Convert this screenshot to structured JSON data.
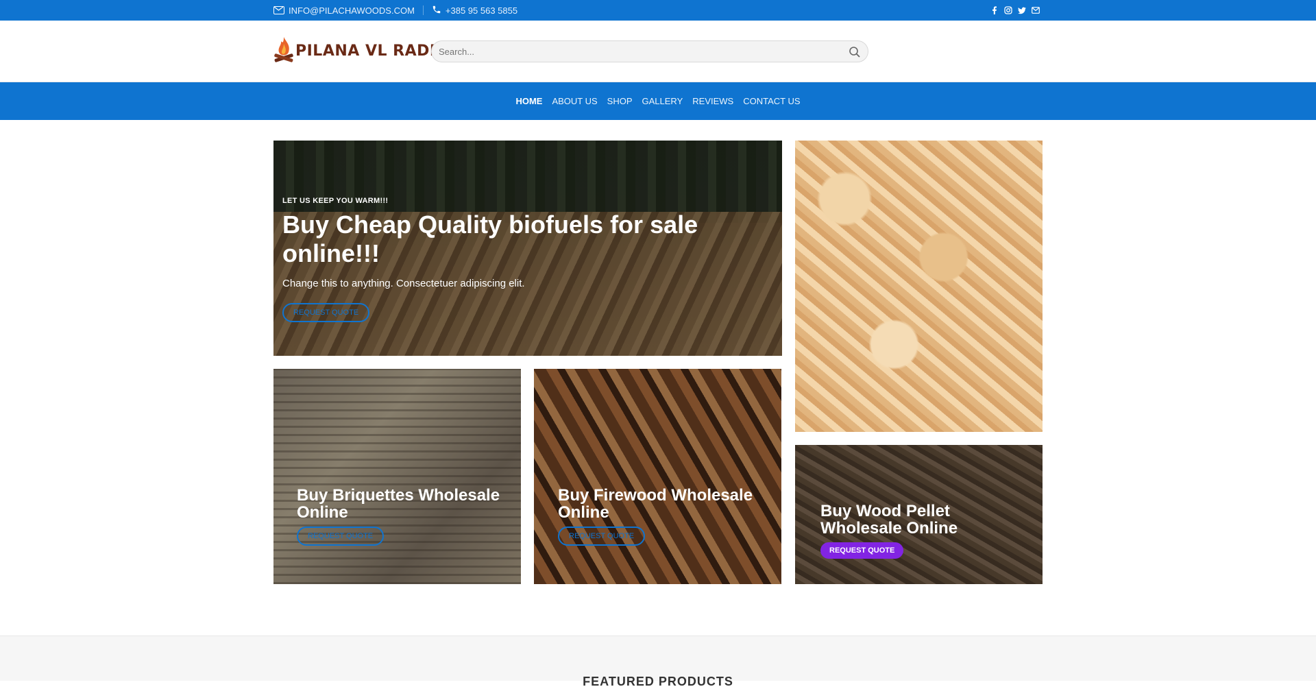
{
  "topbar": {
    "email": "INFO@PILACHAWOODS.COM",
    "phone": "+385 95 563 5855",
    "social": [
      "facebook-icon",
      "instagram-icon",
      "twitter-icon",
      "email-icon"
    ]
  },
  "header": {
    "logo_text": "PILANA VL RADE",
    "search_placeholder": "Search..."
  },
  "nav": {
    "items": [
      "HOME",
      "ABOUT US",
      "SHOP",
      "GALLERY",
      "REVIEWS",
      "CONTACT US"
    ]
  },
  "hero": {
    "kicker": "LET US KEEP YOU WARM!!!",
    "title": "Buy Cheap Quality biofuels for sale online!!!",
    "text": "Change this to anything. Consectetuer adipiscing elit.",
    "button": "REQUEST QUOTE"
  },
  "tiles": {
    "briquettes": {
      "title": "Buy Briquettes Wholesale Online",
      "button": "REQUEST QUOTE"
    },
    "firewood": {
      "title": "Buy Firewood Wholesale Online",
      "button": "REQUEST QUOTE"
    },
    "pellet": {
      "title": "Buy Wood Pellet Wholesale Online",
      "button": "REQUEST QUOTE"
    }
  },
  "featured": {
    "heading": "FEATURED PRODUCTS"
  },
  "colors": {
    "brand_blue": "#0f74d0",
    "button_purple": "#8224e3",
    "logo_brown": "#6a2a16"
  }
}
